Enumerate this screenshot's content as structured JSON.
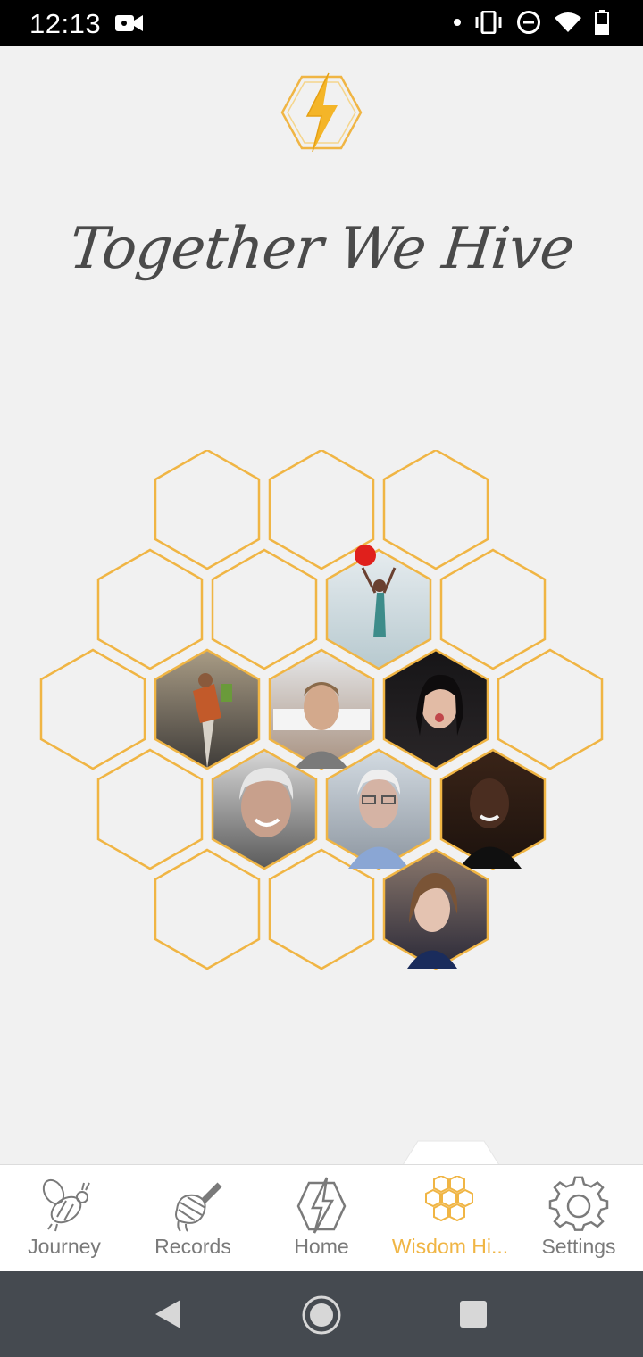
{
  "status": {
    "time": "12:13"
  },
  "app": {
    "tagline": "Together We Hive"
  },
  "hive": {
    "accent": "#f0b544",
    "photo_cells": [
      {
        "id": "girl-jumping-photo",
        "colors": [
          "#dfe6ea",
          "#b9c9d0"
        ]
      },
      {
        "id": "boy-running-photo",
        "colors": [
          "#9a8d7a",
          "#3e3c3a"
        ]
      },
      {
        "id": "young-man-photo",
        "colors": [
          "#e2e4e6",
          "#b59a86"
        ]
      },
      {
        "id": "woman-dark-hair-photo",
        "colors": [
          "#1b1a1d",
          "#d8b7a3"
        ]
      },
      {
        "id": "older-woman-photo",
        "colors": [
          "#cfcfcf",
          "#5f5f5f"
        ]
      },
      {
        "id": "older-man-photo",
        "colors": [
          "#c9d3dc",
          "#8a8f96"
        ]
      },
      {
        "id": "smiling-man-photo",
        "colors": [
          "#2a1a13",
          "#6a4432"
        ]
      },
      {
        "id": "young-woman-photo",
        "colors": [
          "#8d7a6e",
          "#2b2a38"
        ]
      }
    ]
  },
  "tabs": [
    {
      "label": "Journey",
      "icon": "bee-icon"
    },
    {
      "label": "Records",
      "icon": "honey-dipper-icon"
    },
    {
      "label": "Home",
      "icon": "bolt-hexagon-icon"
    },
    {
      "label": "Wisdom Hi...",
      "icon": "honeycomb-icon",
      "active": true
    },
    {
      "label": "Settings",
      "icon": "gear-icon"
    }
  ],
  "nav": {
    "back": "back-icon",
    "home": "home-circle-icon",
    "recents": "recents-square-icon"
  }
}
